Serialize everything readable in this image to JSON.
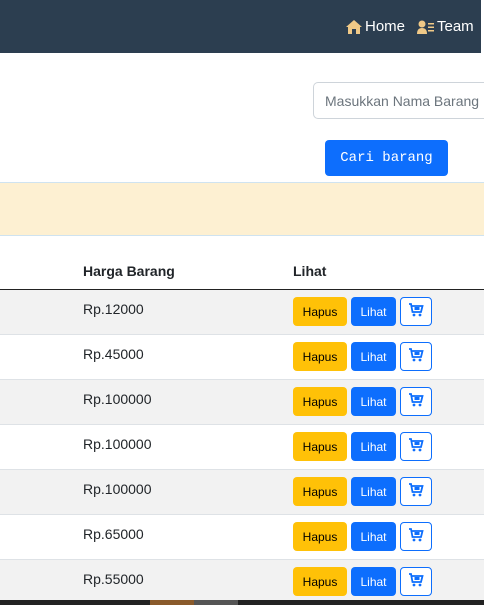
{
  "nav": {
    "home_label": "Home",
    "team_label": "Team"
  },
  "search": {
    "placeholder": "Masukkan Nama Barang",
    "button_label": "Cari barang"
  },
  "table": {
    "columns": [
      "Harga Barang",
      "Lihat"
    ],
    "rows": [
      {
        "price": "Rp.12000"
      },
      {
        "price": "Rp.45000"
      },
      {
        "price": "Rp.100000"
      },
      {
        "price": "Rp.100000"
      },
      {
        "price": "Rp.100000"
      },
      {
        "price": "Rp.65000"
      },
      {
        "price": "Rp.55000"
      }
    ],
    "actions": {
      "delete_label": "Hapus",
      "view_label": "Lihat",
      "cart_icon": "cart-icon"
    }
  },
  "colors": {
    "navbar": "#2c3e50",
    "primary": "#0d6efd",
    "warning": "#ffc107",
    "alert_bg": "#fdf0d2"
  }
}
